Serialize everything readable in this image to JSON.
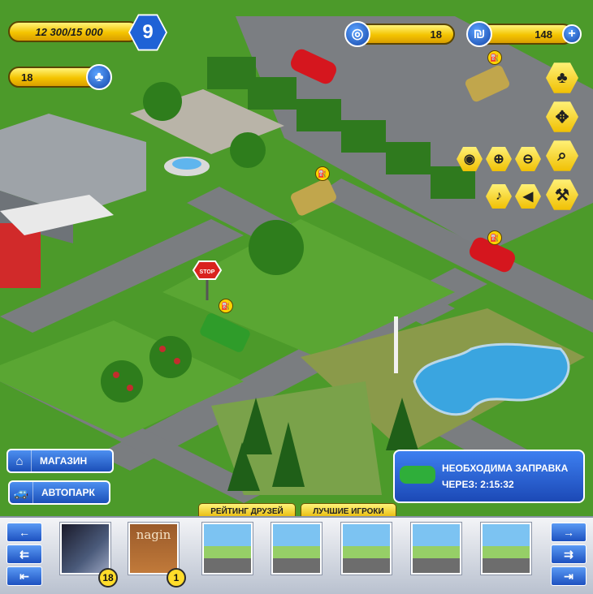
{
  "hud": {
    "xp": "12 300/15 000",
    "level": "9",
    "trees": "18",
    "tires": "18",
    "money": "148",
    "plus": "+"
  },
  "icons": {
    "tree": "♣",
    "tire": "◎",
    "money": "₪",
    "move": "✥",
    "eye": "◉",
    "zoom_in": "⊕",
    "zoom_out": "⊖",
    "search": "⌕",
    "music": "♪",
    "sound": "◀",
    "settings": "⚒",
    "house": "⌂",
    "car": "🚙",
    "fuel": "⛽"
  },
  "left_buttons": {
    "shop": "МАГАЗИН",
    "garage": "АВТОПАРК"
  },
  "notice": {
    "line1": "НЕОБХОДИМА ЗАПРАВКА",
    "line2": "ЧЕРЕЗ: 2:15:32"
  },
  "map_sign": "STOP",
  "tabs": {
    "friends": "РЕЙТИНГ ДРУЗЕЙ",
    "top": "ЛУЧШИЕ ИГРОКИ"
  },
  "nav": {
    "left": [
      "←",
      "⇇",
      "⇤"
    ],
    "right": [
      "→",
      "⇉",
      "⇥"
    ]
  },
  "friends": [
    {
      "badge": "18"
    },
    {
      "name": "nagin",
      "badge": "1"
    }
  ]
}
